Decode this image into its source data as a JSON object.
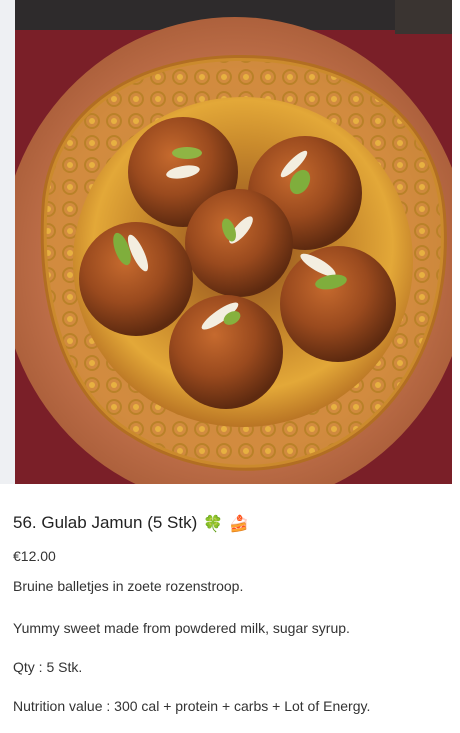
{
  "product": {
    "title": "56. Gulab Jamun (5 Stk)",
    "emoji_clover": "🍀",
    "emoji_cake": "🍰",
    "price": "€12.00",
    "description_nl": "Bruine balletjes in zoete rozenstroop.",
    "description_en": "Yummy sweet made from powdered milk, sugar syrup.",
    "quantity": "Qty : 5 Stk.",
    "nutrition": "Nutrition value : 300 cal + protein + carbs + Lot of Energy."
  },
  "image": {
    "subject": "gulab-jamun-in-clay-bowl"
  }
}
